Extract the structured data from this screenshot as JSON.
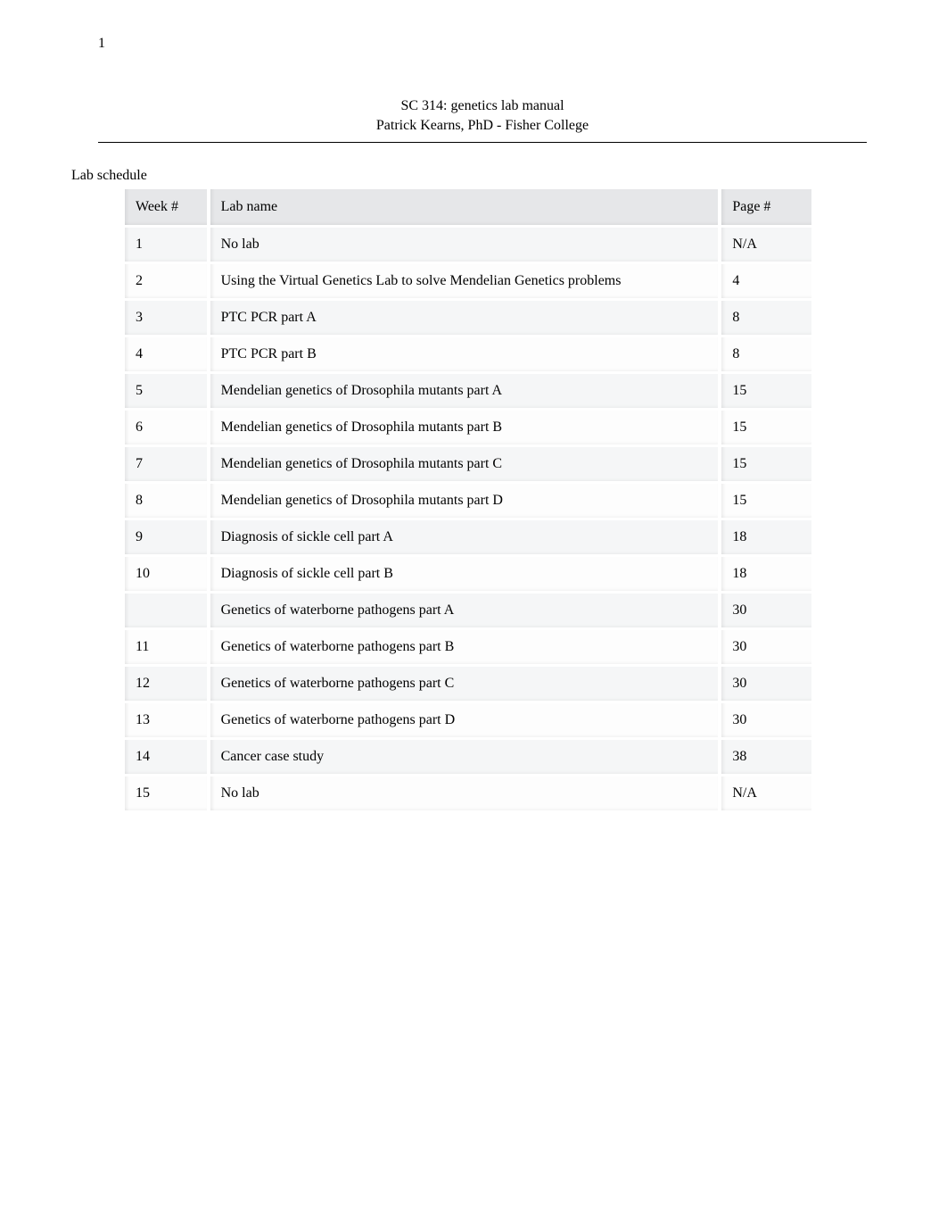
{
  "page_number_top": "1",
  "header": {
    "line1": "SC 314: genetics lab manual",
    "line2": "Patrick Kearns, PhD - Fisher College"
  },
  "section_title": "Lab schedule",
  "columns": {
    "week": "Week  #",
    "labname": "Lab name",
    "page": "Page #"
  },
  "rows": [
    {
      "week": "1",
      "lab": "No lab",
      "page": "N/A"
    },
    {
      "week": "2",
      "lab": "Using the Virtual Genetics Lab to solve Mendelian Genetics problems",
      "page": "4"
    },
    {
      "week": "3",
      "lab": "PTC PCR part A",
      "page": "8"
    },
    {
      "week": "4",
      "lab": "PTC PCR part B",
      "page": "8"
    },
    {
      "week": "5",
      "lab": "Mendelian genetics of Drosophila mutants part A",
      "page": "15"
    },
    {
      "week": "6",
      "lab": "Mendelian genetics of Drosophila mutants part B",
      "page": "15"
    },
    {
      "week": "7",
      "lab": "Mendelian genetics of Drosophila mutants part C",
      "page": "15"
    },
    {
      "week": "8",
      "lab": "Mendelian genetics of Drosophila mutants part D",
      "page": "15"
    },
    {
      "week": "9",
      "lab": "Diagnosis of sickle cell part A",
      "page": "18"
    },
    {
      "week": "10",
      "lab": "Diagnosis of sickle cell part B",
      "page": "18"
    },
    {
      "week": "",
      "lab": "Genetics of waterborne pathogens part A",
      "page": "30"
    },
    {
      "week": "11",
      "lab": "Genetics of waterborne pathogens part B",
      "page": "30"
    },
    {
      "week": "12",
      "lab": "Genetics of waterborne pathogens part C",
      "page": "30"
    },
    {
      "week": "13",
      "lab": "Genetics of waterborne pathogens part D",
      "page": "30"
    },
    {
      "week": "14",
      "lab": "Cancer case study",
      "page": "38"
    },
    {
      "week": "15",
      "lab": "No lab",
      "page": "N/A"
    }
  ]
}
